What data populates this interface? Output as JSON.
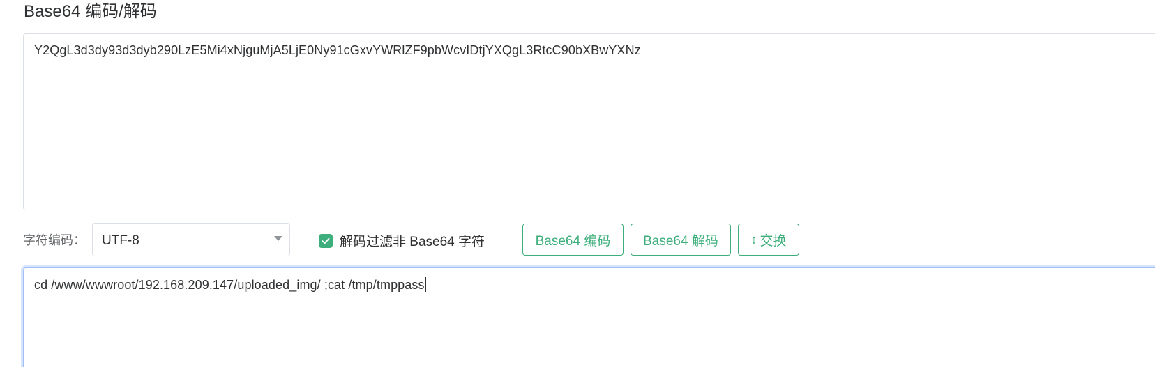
{
  "header": {
    "title": "Base64 编码/解码"
  },
  "input": {
    "value": "Y2QgL3d3dy93d3dyb290LzE5Mi4xNjguMjA5LjE0Ny91cGxvYWRlZF9pbWcvIDtjYXQgL3RtcC90bXBwYXNz"
  },
  "controls": {
    "charset_label": "字符编码：",
    "charset_value": "UTF-8",
    "filter_checkbox_label": "解码过滤非 Base64 字符",
    "filter_checked": true,
    "encode_button": "Base64 编码",
    "decode_button": "Base64 解码",
    "swap_button": "交换",
    "swap_icon": "swap-vertical-icon"
  },
  "output": {
    "value": "cd /www/wwwroot/192.168.209.147/uploaded_img/ ;cat /tmp/tmppass"
  },
  "colors": {
    "accent": "#3eaf7c",
    "border": "#dcdfe6",
    "focus_border": "#a0bff5"
  }
}
